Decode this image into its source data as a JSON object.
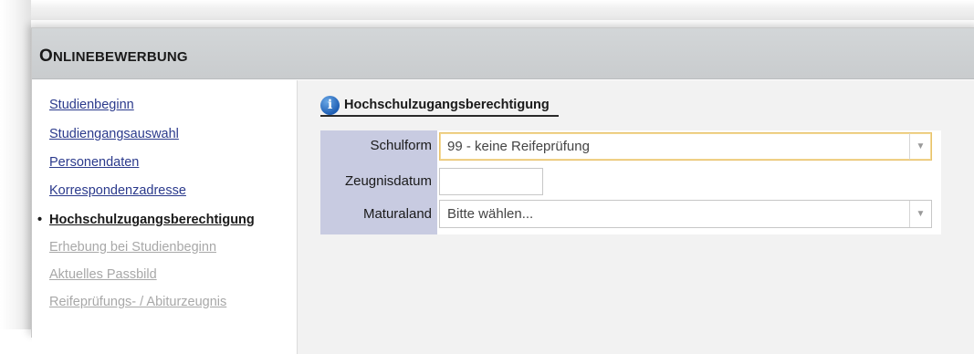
{
  "header": {
    "title_first": "O",
    "title_rest": "NLINEBEWERBUNG"
  },
  "sidebar": {
    "items": [
      {
        "label": "Studienbeginn",
        "state": "link"
      },
      {
        "label": "Studiengangsauswahl",
        "state": "link"
      },
      {
        "label": "Personendaten",
        "state": "link"
      },
      {
        "label": "Korrespondenzadresse",
        "state": "link"
      },
      {
        "label": "Hochschulzugangsberechtigung",
        "state": "active"
      },
      {
        "label": "Erhebung bei Studienbeginn",
        "state": "disabled"
      },
      {
        "label": "Aktuelles Passbild",
        "state": "disabled"
      },
      {
        "label": "Reifeprüfungs- / Abiturzeugnis",
        "state": "disabled"
      }
    ],
    "bullet": "•"
  },
  "section": {
    "icon": "info-icon",
    "icon_glyph": "i",
    "title": "Hochschulzugangsberechtigung"
  },
  "form": {
    "schulform": {
      "label": "Schulform",
      "value": "99 - keine Reifeprüfung"
    },
    "zeugnisdatum": {
      "label": "Zeugnisdatum",
      "value": ""
    },
    "maturaland": {
      "label": "Maturaland",
      "placeholder": "Bitte wählen..."
    },
    "dropdown_glyph": "▼"
  },
  "colors": {
    "link": "#2b3a8c",
    "disabled": "#a8a8a8",
    "label_column": "#c8cbe1",
    "header_bar": "#cfd2d4",
    "focus_border": "#e8c26a"
  }
}
